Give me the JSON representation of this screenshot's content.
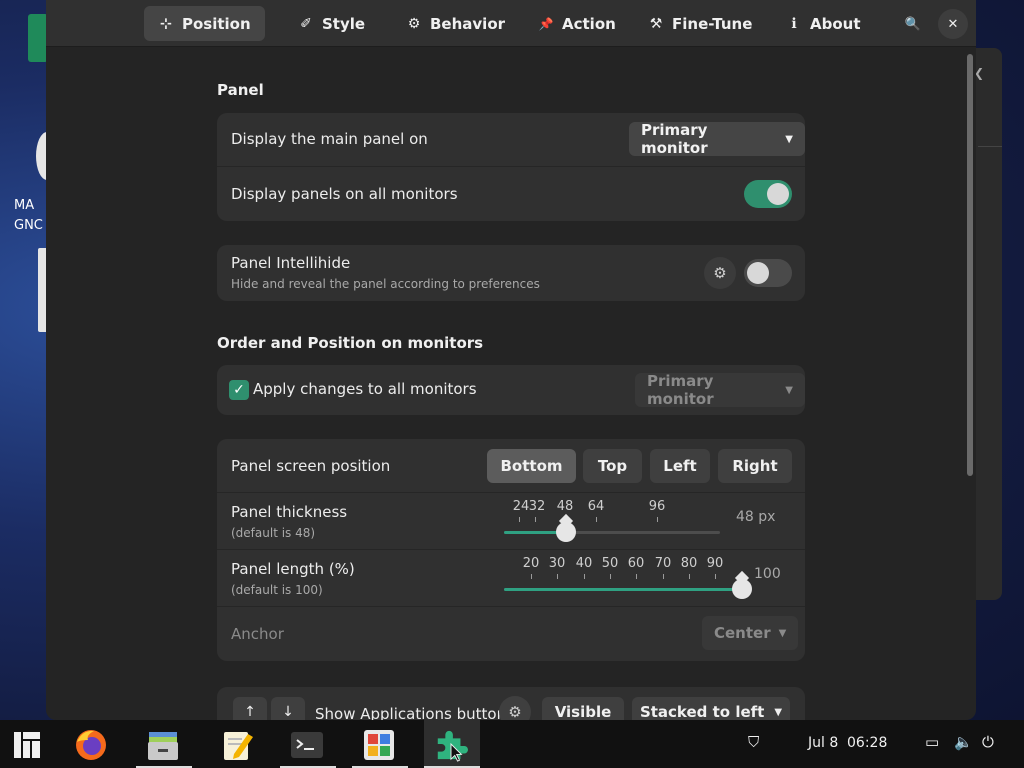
{
  "desktop": {
    "icon_label_line1": "MA",
    "icon_label_line2": "GNC"
  },
  "headerbar": {
    "tabs": [
      {
        "label": "Position",
        "icon": "crosshair-icon",
        "glyph": "⊹"
      },
      {
        "label": "Style",
        "icon": "brush-icon",
        "glyph": "✐"
      },
      {
        "label": "Behavior",
        "icon": "gear-icon",
        "glyph": "⚙"
      },
      {
        "label": "Action",
        "icon": "pin-icon",
        "glyph": "📌"
      },
      {
        "label": "Fine-Tune",
        "icon": "tweak-icon",
        "glyph": "⚒"
      },
      {
        "label": "About",
        "icon": "info-icon",
        "glyph": "ℹ"
      }
    ],
    "search_glyph": "🔍",
    "close_glyph": "✕"
  },
  "panel_section": {
    "title": "Panel",
    "main_panel_label": "Display the main panel on",
    "main_panel_value": "Primary monitor",
    "all_monitors_label": "Display panels on all monitors",
    "all_monitors_on": true
  },
  "intellihide": {
    "title": "Panel Intellihide",
    "subtitle": "Hide and reveal the panel according to preferences",
    "enabled": false
  },
  "order_section": {
    "title": "Order and Position on monitors",
    "apply_all_label": "Apply changes to all monitors",
    "apply_all_checked": true,
    "monitor_value": "Primary monitor"
  },
  "position_card": {
    "screen_position_label": "Panel screen position",
    "positions": [
      "Bottom",
      "Top",
      "Left",
      "Right"
    ],
    "selected_position": "Bottom",
    "thickness": {
      "title": "Panel thickness",
      "subtitle": "(default is 48)",
      "ticks": [
        "24",
        "32",
        "48",
        "64",
        "96"
      ],
      "value": 48,
      "min": 16,
      "max": 128,
      "value_label": "48 px"
    },
    "length": {
      "title": "Panel length (%)",
      "subtitle": "(default is 100)",
      "ticks": [
        "20",
        "30",
        "40",
        "50",
        "60",
        "70",
        "80",
        "90"
      ],
      "value": 100,
      "min": 10,
      "max": 100,
      "value_label": "100"
    },
    "anchor_label": "Anchor",
    "anchor_value": "Center"
  },
  "apps_row": {
    "up_glyph": "↑",
    "down_glyph": "↓",
    "label": "Show Applications button",
    "visibility": "Visible",
    "placement": "Stacked to left"
  },
  "taskbar": {
    "apps": [
      {
        "name": "app-grid-icon"
      },
      {
        "name": "firefox-icon"
      },
      {
        "name": "files-icon"
      },
      {
        "name": "text-editor-icon"
      },
      {
        "name": "terminal-icon"
      },
      {
        "name": "software-center-icon"
      },
      {
        "name": "extensions-icon"
      }
    ],
    "date": "Jul 8",
    "time": "06:28"
  },
  "colors": {
    "accent": "#2f8f6e",
    "window_bg": "#242424",
    "card_bg": "#303030"
  }
}
